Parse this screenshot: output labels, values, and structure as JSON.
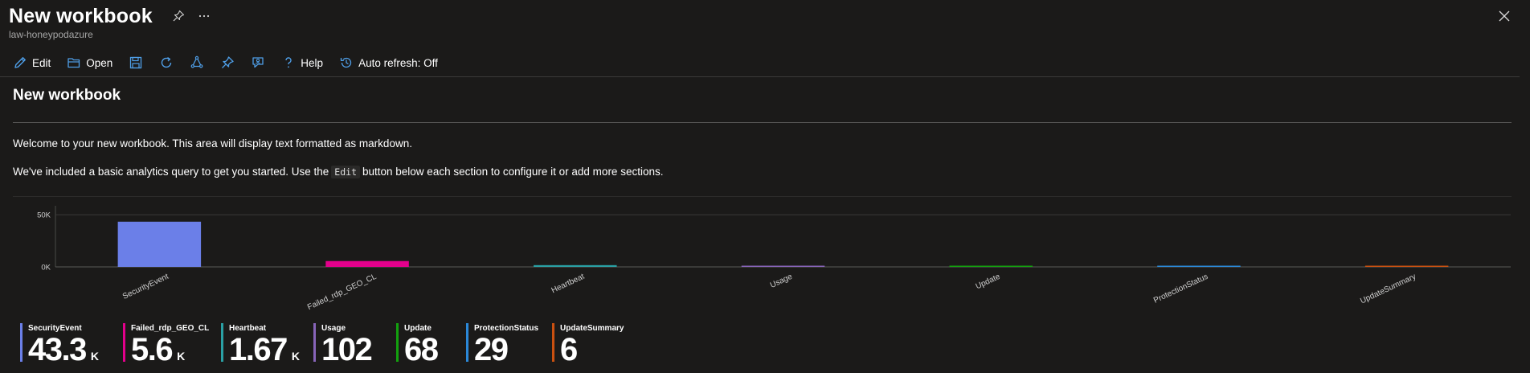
{
  "header": {
    "title": "New workbook",
    "subtitle": "law-honeypodazure",
    "pin_icon": "pin-icon",
    "more_icon": "more-icon",
    "close_icon": "close-icon"
  },
  "toolbar": {
    "edit_label": "Edit",
    "open_label": "Open",
    "help_label": "Help",
    "auto_refresh_label": "Auto refresh: Off",
    "icons": [
      "edit-icon",
      "open-folder-icon",
      "save-icon",
      "refresh-icon",
      "shared-workbook-icon",
      "pin-icon",
      "feedback-icon",
      "help-icon",
      "auto-refresh-icon"
    ]
  },
  "content": {
    "title": "New workbook",
    "markdown_line1": "Welcome to your new workbook. This area will display text formatted as markdown.",
    "markdown_line2_before": "We've included a basic analytics query to get you started. Use the",
    "markdown_code": "Edit",
    "markdown_line2_after": "button below each section to configure it or add more sections."
  },
  "chart_data": {
    "type": "bar",
    "categories": [
      "SecurityEvent",
      "Failed_rdp_GEO_CL",
      "Heartbeat",
      "Usage",
      "Update",
      "ProtectionStatus",
      "UpdateSummary"
    ],
    "values": [
      43300,
      5600,
      1670,
      102,
      68,
      29,
      6
    ],
    "colors": [
      "#6b7fe8",
      "#e3008c",
      "#2aa0a4",
      "#8764b8",
      "#13a10e",
      "#2b88d8",
      "#ca5010"
    ],
    "y_tick_labels": [
      "50K",
      "0K"
    ],
    "y_ticks": [
      50000,
      0
    ],
    "ylim": [
      0,
      57000
    ],
    "grid": true
  },
  "tiles": [
    {
      "name": "SecurityEvent",
      "value": "43.3",
      "unit": "K",
      "color": "#6b7fe8"
    },
    {
      "name": "Failed_rdp_GEO_CL",
      "value": "5.6",
      "unit": "K",
      "color": "#e3008c"
    },
    {
      "name": "Heartbeat",
      "value": "1.67",
      "unit": "K",
      "color": "#2aa0a4"
    },
    {
      "name": "Usage",
      "value": "102",
      "unit": "",
      "color": "#8764b8"
    },
    {
      "name": "Update",
      "value": "68",
      "unit": "",
      "color": "#13a10e"
    },
    {
      "name": "ProtectionStatus",
      "value": "29",
      "unit": "",
      "color": "#2b88d8"
    },
    {
      "name": "UpdateSummary",
      "value": "6",
      "unit": "",
      "color": "#ca5010"
    }
  ],
  "colors": {
    "background": "#1b1a19",
    "accent": "#4f9fe8"
  }
}
